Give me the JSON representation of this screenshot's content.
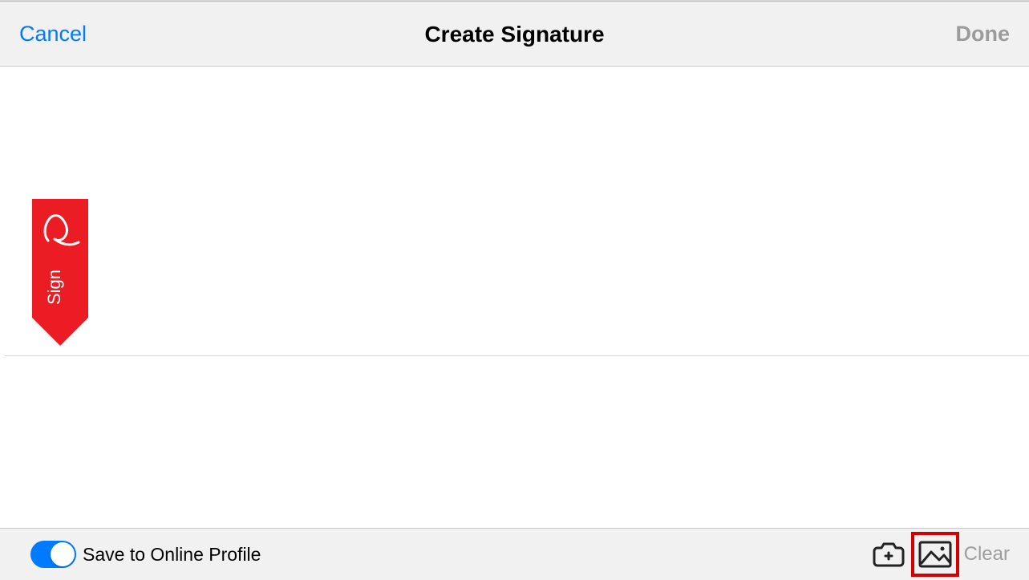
{
  "header": {
    "cancel_label": "Cancel",
    "title": "Create Signature",
    "done_label": "Done"
  },
  "sign_tab": {
    "label": "Sign",
    "color": "#ec1c24"
  },
  "footer": {
    "toggle_on": true,
    "toggle_label": "Save to Online Profile",
    "clear_label": "Clear",
    "icons": {
      "camera": "camera-icon",
      "image": "image-icon"
    }
  }
}
